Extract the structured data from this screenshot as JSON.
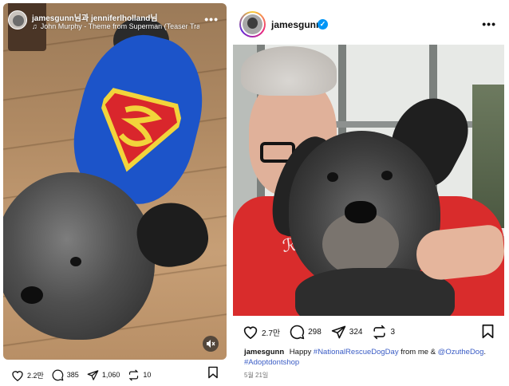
{
  "left_post": {
    "users": "jamesgunn님과 jenniferlholland님",
    "music": "John Murphy - Theme from Superman (Teaser Trailer V...",
    "more_icon": "more-horizontal-icon",
    "mute_icon": "speaker-muted-icon",
    "likes": "2.2만",
    "comments": "385",
    "shares": "1,060",
    "reposts": "10"
  },
  "right_post": {
    "username": "jamesgunn",
    "verified_icon": "verified-badge-icon",
    "likes": "2.7만",
    "comments": "298",
    "shares": "324",
    "reposts": "3",
    "caption": {
      "user": "jamesgunn",
      "text_1": "Happy",
      "hashtag_1": "#NationalRescueDogDay",
      "text_2": "from me &",
      "mention": "@OzutheDog",
      "text_3": ".",
      "hashtag_2": "#Adoptdontshop"
    },
    "date": "5월 21일"
  },
  "colors": {
    "link": "#3a5cc5",
    "verified": "#0095f6",
    "superman_blue": "#1c54c9",
    "superman_red": "#d9262c",
    "superman_yellow": "#f2d43b"
  }
}
